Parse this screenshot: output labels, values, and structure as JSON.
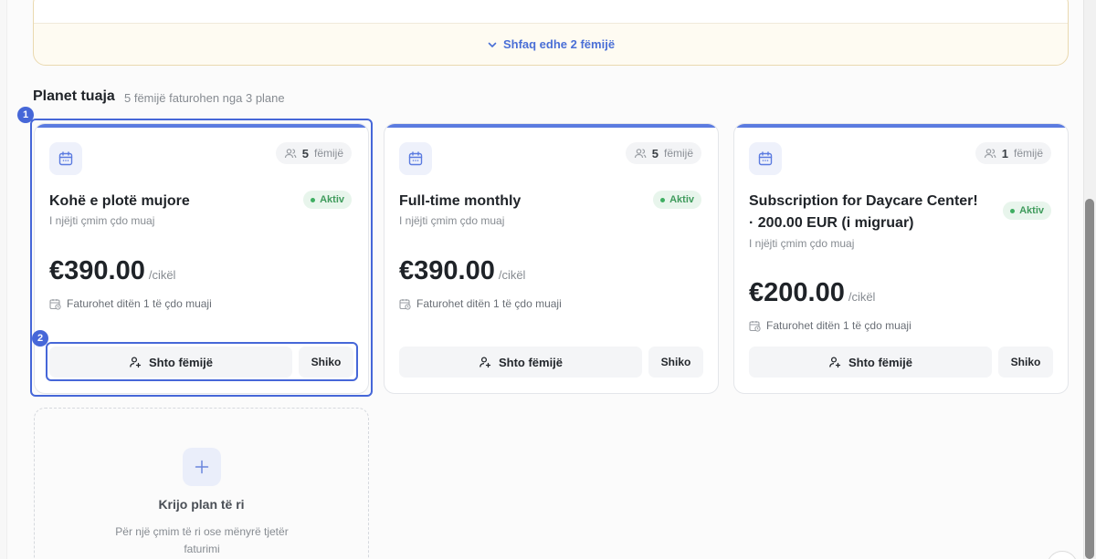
{
  "top_section": {
    "show_more_label": "Shfaq edhe 2 fëmijë"
  },
  "plans_section": {
    "title": "Planet tuaja",
    "subtitle": "5 fëmijë faturohen nga 3 plane"
  },
  "plans": [
    {
      "count": "5",
      "count_unit": "fëmijë",
      "name": "Kohë e plotë mujore",
      "status": "Aktiv",
      "description": "I njëjti çmim çdo muaj",
      "price": "€390.00",
      "period": "/cikël",
      "billing": "Faturohet ditën 1 të çdo muaji",
      "add_label": "Shto fëmijë",
      "view_label": "Shiko"
    },
    {
      "count": "5",
      "count_unit": "fëmijë",
      "name": "Full-time monthly",
      "status": "Aktiv",
      "description": "I njëjti çmim çdo muaj",
      "price": "€390.00",
      "period": "/cikël",
      "billing": "Faturohet ditën 1 të çdo muaji",
      "add_label": "Shto fëmijë",
      "view_label": "Shiko"
    },
    {
      "count": "1",
      "count_unit": "fëmijë",
      "name": "Subscription for Daycare Center! · 200.00 EUR (i migruar)",
      "status": "Aktiv",
      "description": "I njëjti çmim çdo muaj",
      "price": "€200.00",
      "period": "/cikël",
      "billing": "Faturohet ditën 1 të çdo muaji",
      "add_label": "Shto fëmijë",
      "view_label": "Shiko"
    }
  ],
  "new_plan": {
    "title": "Krijo plan të ri",
    "description": "Për një çmim të ri ose mënyrë tjetër faturimi"
  },
  "annotations": [
    "1",
    "2"
  ],
  "colors": {
    "accent": "#4667d8",
    "status_green": "#3f9b5c",
    "top_card_bg": "#fefbf2"
  },
  "icons": {
    "calendar": "calendar-icon",
    "users": "users-icon",
    "add_user": "user-plus-icon",
    "billing": "calendar-clock-icon",
    "chevron": "chevron-down-icon",
    "plus": "plus-icon"
  }
}
